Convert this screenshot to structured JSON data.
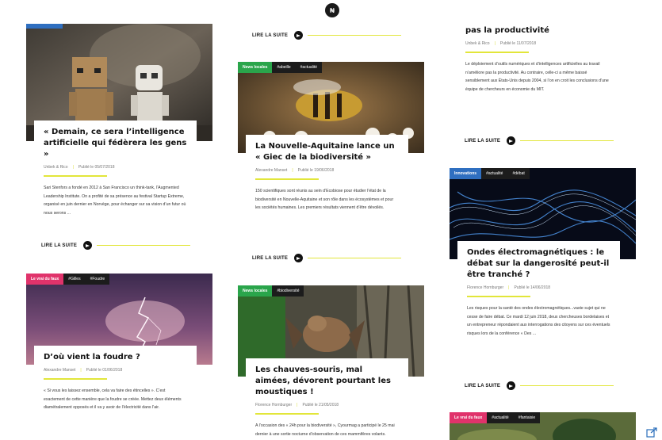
{
  "logo_glyph": "₦",
  "lire_label": "LIRE LA SUITE",
  "col1": {
    "card1": {
      "title": "« Demain, ce sera l’intelligence artificielle qui fédèrera les gens »",
      "author": "Unbek & Rico",
      "date": "Publié le 05/07/2018",
      "excerpt": "Sari Stenfors a fondé en 2012 à San Francisco un think-tank, l’Augmented Leadership Institute. On a profité de sa présence au festival Startup Extreme, organisé en juin dernier en Norvège, pour échanger sur sa vision d’un futur où nous serons ..."
    },
    "card2": {
      "tags": [
        "Le vrai du faux",
        "#Gilles",
        "#Foudre"
      ],
      "title": "D’où vient la foudre ?",
      "author": "Alexandre Manset",
      "date": "Publié le 01/06/2018",
      "excerpt": "« Si vous les laissez ensemble, cela va faire des étincelles ». C’est exactement de cette manière que la foudre se créée. Mettez deux éléments diamétralement opposés et il va y avoir de l’électricité dans l’air."
    }
  },
  "col2": {
    "card1": {
      "tags": [
        "News locales",
        "#abeille",
        "#actualité"
      ],
      "title": "La Nouvelle-Aquitaine lance un « Giec de la biodiversité »",
      "author": "Alexandre Manset",
      "date": "Publié le 19/06/2018",
      "excerpt": "150 scientifiques sont réunis au sein d’Ecobiose pour étudier l’état de la biodiversité en Nouvelle-Aquitaine et son rôle dans les écosystèmes et pour les sociétés humaines. Les premiers résultats viennent d’être dévoilés."
    },
    "card2": {
      "tags": [
        "News locales",
        "#biodiversité"
      ],
      "title": "Les chauves-souris, mal aimées, dévorent pourtant les moustiques !",
      "author": "Florence Hornburger",
      "date": "Publié le 21/05/2018",
      "excerpt": "A l’occasion des « 24h pour la biodiversité », Cyourmag a participé le 25 mai dernier à une sortie nocturne d’observation de ces mammifères volants."
    }
  },
  "col3": {
    "card0": {
      "title": "pas la productivité",
      "author": "Unbek & Rico",
      "date": "Publié le 11/07/2018",
      "excerpt": "Le déploiement d’outils numériques et d’intelligences artificielles au travail n’améliore pas la productivité. Au contraire, celle-ci a même baissé sensiblement aux États-Unis depuis 2004, si l’on en croit les conclusions d’une équipe de chercheurs en économie du MIT."
    },
    "card1": {
      "tags": [
        "Innovations",
        "#actualité",
        "#débat"
      ],
      "title": "Ondes électromagnétiques : le débat sur la dangerosité peut-il être tranché ?",
      "author": "Florence Hornburger",
      "date": "Publié le 14/06/2018",
      "excerpt": "Les risques pour la santé des ondes électromagnétiques...vaste sujet qui ne cesse de faire débat. Ce mardi 12 juin 2018, deux chercheuses bordelaises et un entrepreneur répondaient aux interrogations des citoyens sur ces éventuels risques lors de la conférence « Des ..."
    },
    "card2": {
      "tags": [
        "Le vrai du faux",
        "#actualité",
        "#fantaisie"
      ]
    }
  },
  "colors": {
    "accent": "#e2e63a",
    "pink": "#e0336b",
    "green": "#2aa54b",
    "blue": "#2f6fc0",
    "dark": "#1c1c1c"
  }
}
